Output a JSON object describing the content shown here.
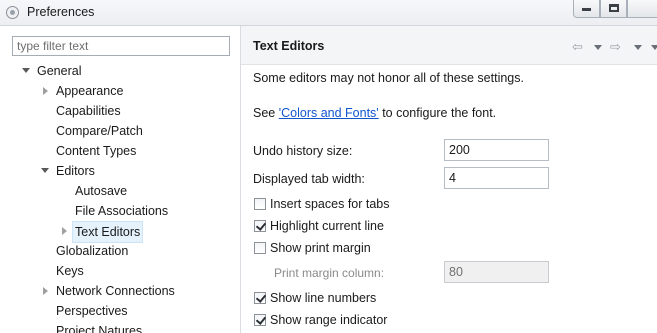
{
  "window": {
    "title": "Preferences"
  },
  "filter": {
    "placeholder": "type filter text",
    "value": ""
  },
  "tree": {
    "items": [
      {
        "label": "General"
      },
      {
        "label": "Appearance"
      },
      {
        "label": "Capabilities"
      },
      {
        "label": "Compare/Patch"
      },
      {
        "label": "Content Types"
      },
      {
        "label": "Editors"
      },
      {
        "label": "Autosave"
      },
      {
        "label": "File Associations"
      },
      {
        "label": "Text Editors"
      },
      {
        "label": "Globalization"
      },
      {
        "label": "Keys"
      },
      {
        "label": "Network Connections"
      },
      {
        "label": "Perspectives"
      },
      {
        "label": "Project Natures"
      }
    ]
  },
  "page": {
    "title": "Text Editors",
    "note": "Some editors may not honor all of these settings.",
    "see_prefix": "See",
    "colors_link": "'Colors and Fonts'",
    "see_suffix": "to configure the font.",
    "undo_label": "Undo history size:",
    "undo_value": "200",
    "tab_width_label": "Displayed tab width:",
    "tab_width_value": "4",
    "insert_spaces_label": "Insert spaces for tabs",
    "insert_spaces_checked": false,
    "highlight_line_label": "Highlight current line",
    "highlight_line_checked": true,
    "print_margin_label": "Show print margin",
    "print_margin_checked": false,
    "print_margin_column_label": "Print margin column:",
    "print_margin_column_value": "80",
    "line_numbers_label": "Show line numbers",
    "line_numbers_checked": true,
    "range_indicator_label": "Show range indicator",
    "range_indicator_checked": true
  },
  "icons": {
    "back": "back-arrow-icon",
    "forward": "forward-arrow-icon"
  }
}
